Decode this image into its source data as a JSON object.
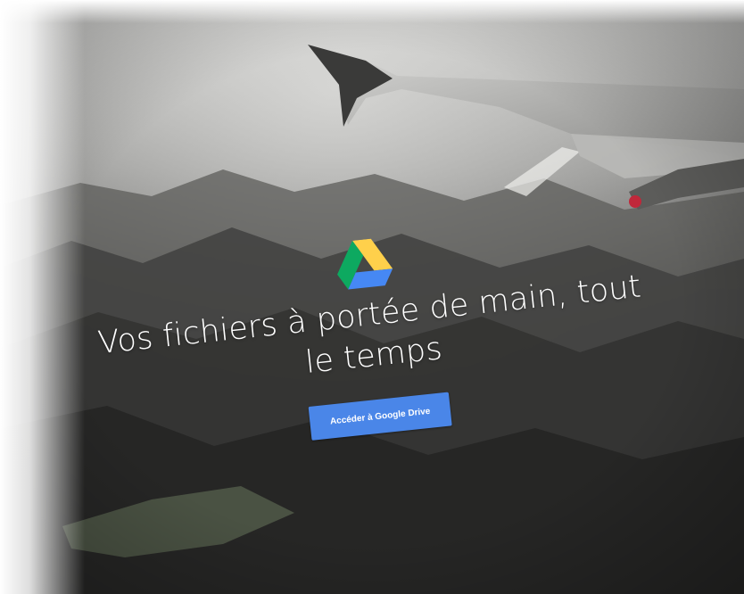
{
  "hero": {
    "logo_icon": "google-drive-icon",
    "headline_line1": "Vos fichiers à portée de main, tout",
    "headline_line2": "le temps",
    "cta_label": "Accéder à Google Drive"
  },
  "background": {
    "description_icon": "airplane-wing-landscape",
    "accent_color": "#4a86e8"
  },
  "drive_logo_colors": {
    "green": "#0da960",
    "yellow": "#ffd04b",
    "blue": "#4688f4"
  }
}
